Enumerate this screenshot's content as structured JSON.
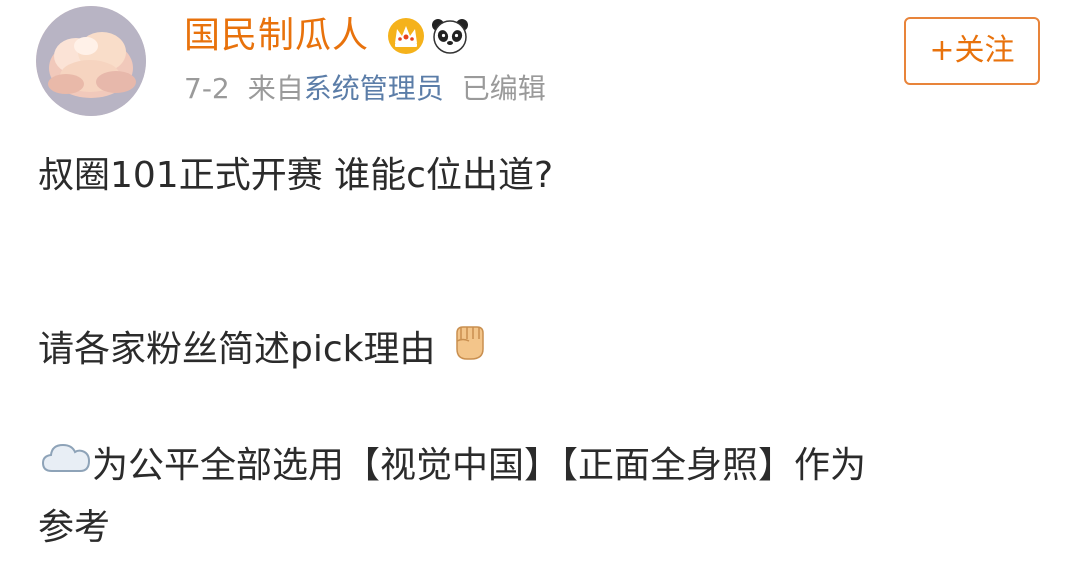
{
  "post": {
    "user": {
      "name": "国民制瓜人",
      "badges": [
        "crown-badge-icon",
        "panda-icon"
      ]
    },
    "meta": {
      "date": "7-2",
      "source_prefix": "来自",
      "source_name": "系统管理员",
      "edited": "已编辑"
    },
    "follow_label": "+关注",
    "lines": {
      "line1": "叔圈101正式开赛 谁能c位出道?",
      "line2": "请各家粉丝简述pick理由",
      "line3": "为公平全部选用【视觉中国】【正面全身照】作为",
      "line4": "参考"
    },
    "colors": {
      "username": "#e8720c",
      "link": "#5b7da8",
      "meta": "#9a9a9a",
      "text": "#2b2b2b",
      "follow_border": "#e8843a"
    },
    "emojis": [
      "fist-emoji-icon",
      "cloud-emoji-icon"
    ]
  }
}
